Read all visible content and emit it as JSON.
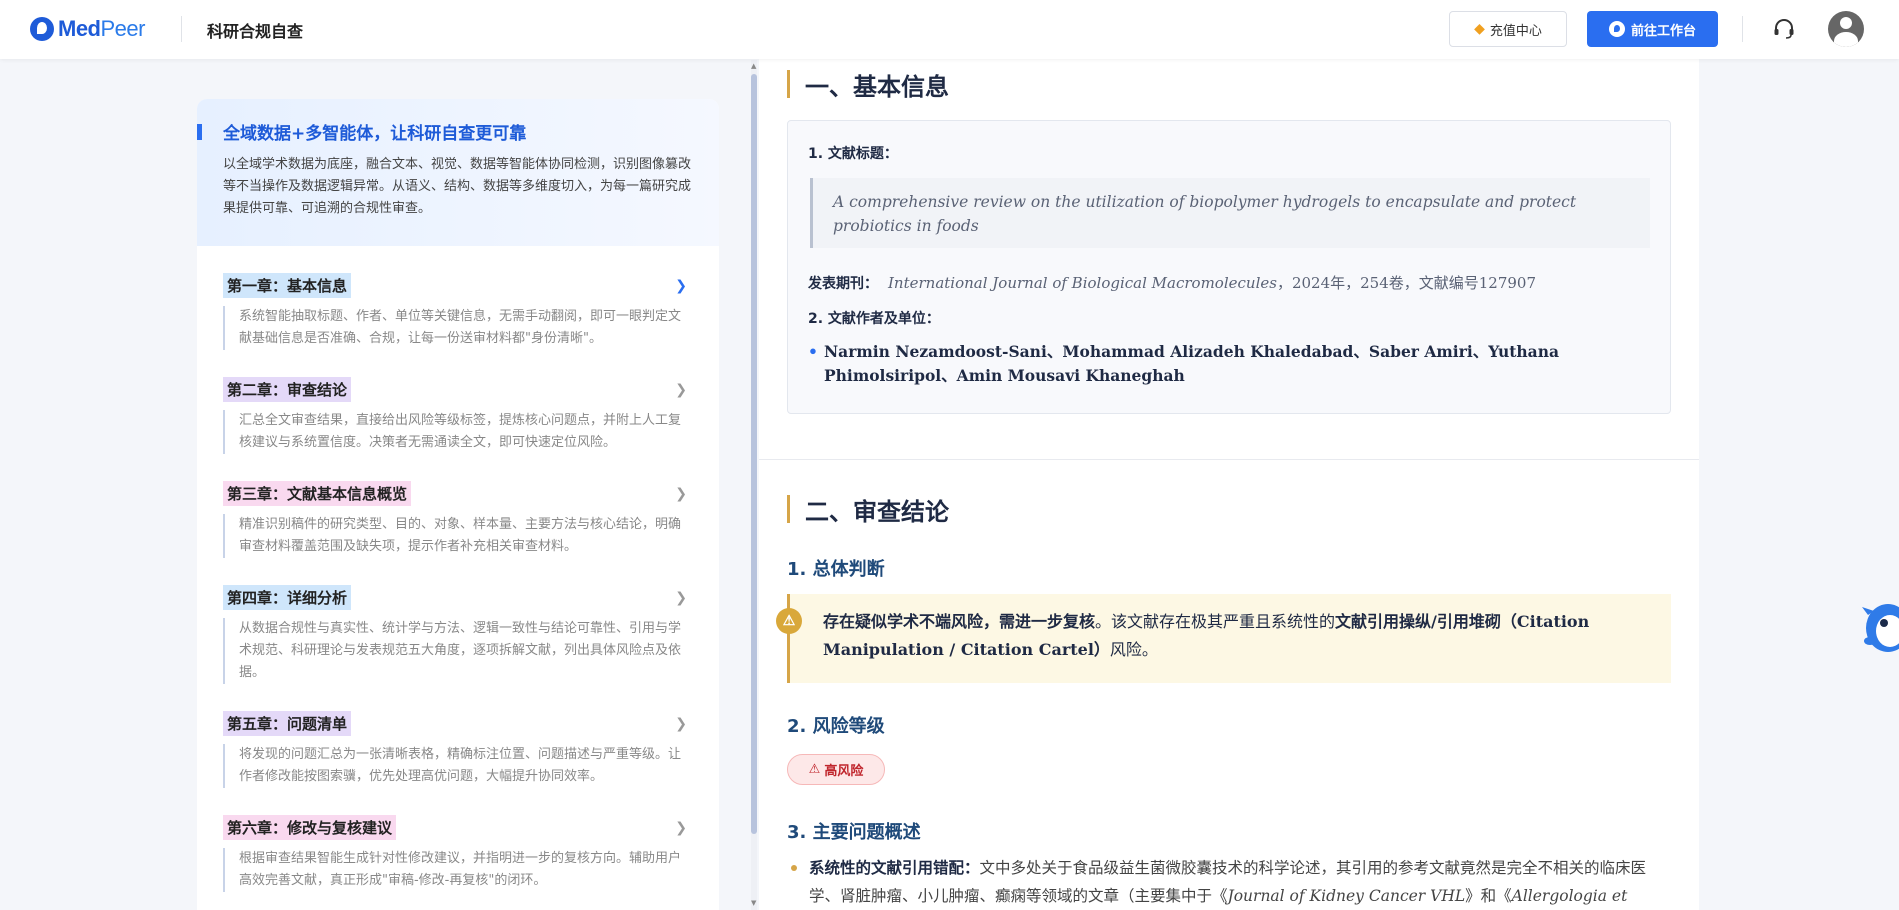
{
  "header": {
    "logo_primary": "Med",
    "logo_secondary": "Peer",
    "title": "科研合规自查",
    "recharge_label": "充值中心",
    "workbench_label": "前往工作台"
  },
  "intro": {
    "title": "全域数据+多智能体，让科研自查更可靠",
    "description": "以全域学术数据为底座，融合文本、视觉、数据等智能体协同检测，识别图像篡改等不当操作及数据逻辑异常。从语义、结构、数据等多维度切入，为每一篇研究成果提供可靠、可追溯的合规性审查。"
  },
  "chapters": [
    {
      "label": "第一章：基本信息",
      "desc": "系统智能抽取标题、作者、单位等关键信息，无需手动翻阅，即可一眼判定文献基础信息是否准确、合规，让每一份送审材料都\"身份清晰\"。",
      "color": "#cfe6fb"
    },
    {
      "label": "第二章：审查结论",
      "desc": "汇总全文审查结果，直接给出风险等级标签，提炼核心问题点，并附上人工复核建议与系统置信度。决策者无需通读全文，即可快速定位风险。",
      "color": "#e4d9f8"
    },
    {
      "label": "第三章：文献基本信息概览",
      "desc": "精准识别稿件的研究类型、目的、对象、样本量、主要方法与核心结论，明确审查材料覆盖范围及缺失项，提示作者补充相关审查材料。",
      "color": "#f9d9ef"
    },
    {
      "label": "第四章：详细分析",
      "desc": "从数据合规性与真实性、统计学与方法、逻辑一致性与结论可靠性、引用与学术规范、科研理论与发表规范五大角度，逐项拆解文献，列出具体风险点及依据。",
      "color": "#cfe6fb"
    },
    {
      "label": "第五章：问题清单",
      "desc": "将发现的问题汇总为一张清晰表格，精确标注位置、问题描述与严重等级。让作者修改能按图索骥，优先处理高优问题，大幅提升协同效率。",
      "color": "#e4d9f8"
    },
    {
      "label": "第六章：修改与复核建议",
      "desc": "根据审查结果智能生成针对性修改建议，并指明进一步的复核方向。辅助用户高效完善文献，真正形成\"审稿-修改-再复核\"的闭环。",
      "color": "#f9d9ef"
    }
  ],
  "doc": {
    "section1_title": "一、基本信息",
    "title_label": "1. 文献标题：",
    "article_title": "A comprehensive review on the utilization of biopolymer hydrogels to encapsulate and protect probiotics in foods",
    "journal_label": "发表期刊：",
    "journal_name": "International Journal of Biological Macromolecules",
    "journal_meta": "，2024年，254卷，文献编号127907",
    "authors_label": "2. 文献作者及单位：",
    "authors": "Narmin Nezamdoost-Sani、Mohammad Alizadeh Khaledabad、Saber Amiri、Yuthana Phimolsiripol、Amin Mousavi Khaneghah",
    "section2_title": "二、审查结论",
    "overall_heading": "1. 总体判断",
    "alert_bold_1": "存在疑似学术不端风险，需进一步复核",
    "alert_text_1": "。该文献存在极其严重且系统性的",
    "alert_bold_2": "文献引用操纵/引用堆砌（Citation Manipulation / Citation Cartel）",
    "alert_text_2": "风险。",
    "risk_heading": "2. 风险等级",
    "risk_badge": "高风险",
    "issues_heading": "3. 主要问题概述",
    "issue_bold": "系统性的文献引用错配：",
    "issue_text_1": "文中多处关于食品级益生菌微胶囊技术的科学论述，其引用的参考文献竟然是完全不相关的临床医学、肾脏肿瘤、小儿肿瘤、癫痫等领域的文章（主要集中于《",
    "issue_italic_1": "Journal of Kidney Cancer VHL",
    "issue_text_2": "》和《",
    "issue_italic_2": "Allergologia et"
  },
  "colors": {
    "brand_blue": "#2a6ef0",
    "accent_gold": "#d6a548",
    "risk_red": "#c0262d"
  }
}
